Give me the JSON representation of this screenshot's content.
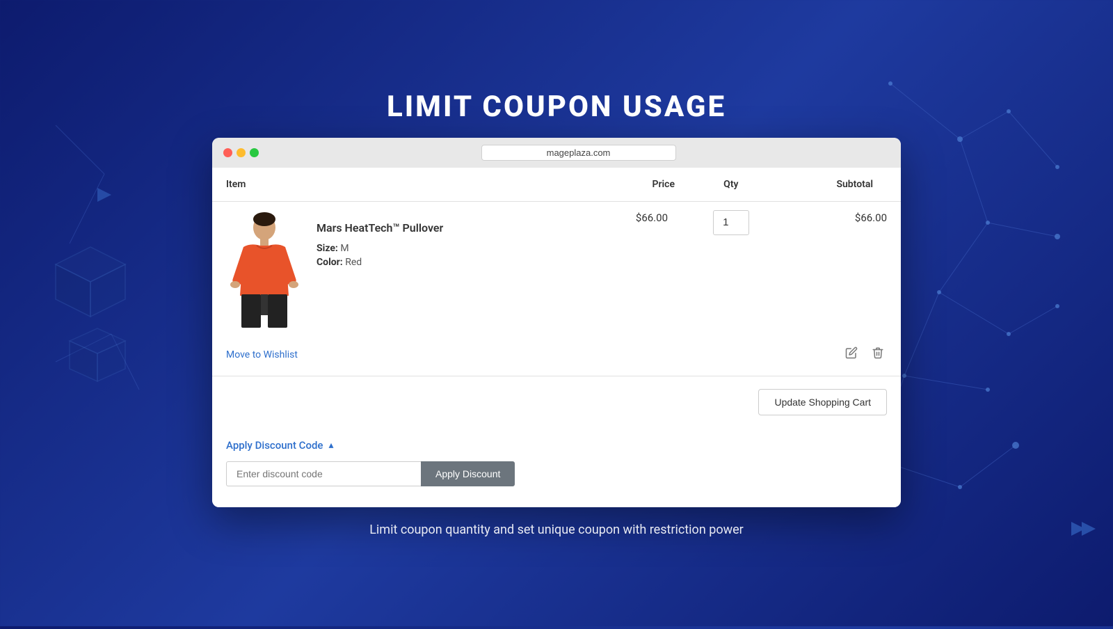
{
  "page": {
    "title": "LIMIT COUPON USAGE",
    "subtitle": "Limit coupon quantity and set unique coupon with restriction power"
  },
  "browser": {
    "address": "mageplaza.com"
  },
  "cart": {
    "headers": {
      "item": "Item",
      "price": "Price",
      "qty": "Qty",
      "subtotal": "Subtotal"
    },
    "product": {
      "name": "Mars HeatTech™ Pullover",
      "price": "$66.00",
      "qty": "1",
      "subtotal": "$66.00",
      "size_label": "Size:",
      "size_value": "M",
      "color_label": "Color:",
      "color_value": "Red"
    },
    "move_to_wishlist": "Move to Wishlist",
    "update_cart_btn": "Update Shopping Cart"
  },
  "discount": {
    "toggle_label": "Apply Discount Code",
    "input_placeholder": "Enter discount code",
    "apply_btn": "Apply Discount"
  }
}
